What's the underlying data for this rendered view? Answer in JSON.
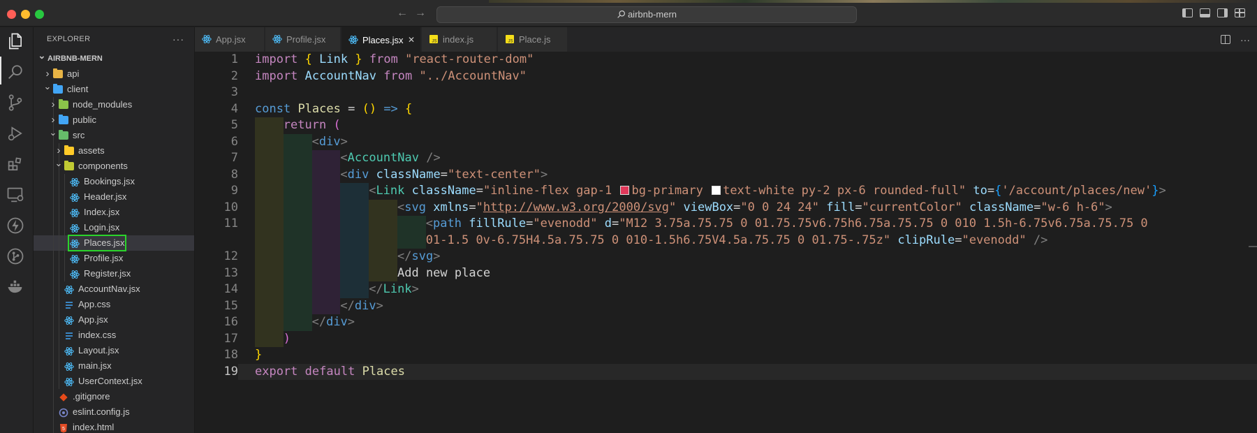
{
  "titlebar": {
    "search_text": "airbnb-mern"
  },
  "explorer": {
    "header": "EXPLORER",
    "more": "···",
    "tree": [
      {
        "label": "AIRBNB-MERN",
        "depth": 0,
        "type": "root",
        "expanded": true
      },
      {
        "label": "api",
        "depth": 1,
        "type": "folder",
        "expanded": false,
        "color": "#e8b445"
      },
      {
        "label": "client",
        "depth": 1,
        "type": "folder",
        "expanded": true,
        "color": "#42a5f5"
      },
      {
        "label": "node_modules",
        "depth": 2,
        "type": "folder",
        "expanded": false,
        "color": "#8bc34a"
      },
      {
        "label": "public",
        "depth": 2,
        "type": "folder",
        "expanded": false,
        "color": "#42a5f5"
      },
      {
        "label": "src",
        "depth": 2,
        "type": "folder",
        "expanded": true,
        "color": "#66bb6a"
      },
      {
        "label": "assets",
        "depth": 3,
        "type": "folder",
        "expanded": false,
        "color": "#ffca28"
      },
      {
        "label": "components",
        "depth": 3,
        "type": "folder",
        "expanded": true,
        "color": "#c0ca33"
      },
      {
        "label": "Bookings.jsx",
        "depth": 4,
        "type": "react"
      },
      {
        "label": "Header.jsx",
        "depth": 4,
        "type": "react"
      },
      {
        "label": "Index.jsx",
        "depth": 4,
        "type": "react"
      },
      {
        "label": "Login.jsx",
        "depth": 4,
        "type": "react"
      },
      {
        "label": "Places.jsx",
        "depth": 4,
        "type": "react",
        "selected": true,
        "highlighted": true
      },
      {
        "label": "Profile.jsx",
        "depth": 4,
        "type": "react"
      },
      {
        "label": "Register.jsx",
        "depth": 4,
        "type": "react"
      },
      {
        "label": "AccountNav.jsx",
        "depth": 3,
        "type": "react"
      },
      {
        "label": "App.css",
        "depth": 3,
        "type": "css"
      },
      {
        "label": "App.jsx",
        "depth": 3,
        "type": "react"
      },
      {
        "label": "index.css",
        "depth": 3,
        "type": "css"
      },
      {
        "label": "Layout.jsx",
        "depth": 3,
        "type": "react"
      },
      {
        "label": "main.jsx",
        "depth": 3,
        "type": "react"
      },
      {
        "label": "UserContext.jsx",
        "depth": 3,
        "type": "react"
      },
      {
        "label": ".gitignore",
        "depth": 2,
        "type": "git"
      },
      {
        "label": "eslint.config.js",
        "depth": 2,
        "type": "eslint"
      },
      {
        "label": "index.html",
        "depth": 2,
        "type": "html"
      }
    ]
  },
  "tabs": [
    {
      "label": "App.jsx",
      "type": "react",
      "active": false
    },
    {
      "label": "Profile.jsx",
      "type": "react",
      "active": false
    },
    {
      "label": "Places.jsx",
      "type": "react",
      "active": true
    },
    {
      "label": "index.js",
      "type": "js",
      "active": false
    },
    {
      "label": "Place.js",
      "type": "js",
      "active": false
    }
  ],
  "editor": {
    "current_line": 19,
    "lines": [
      {
        "n": "1",
        "depth": 0,
        "tokens": [
          [
            "kw",
            "import"
          ],
          [
            "txt",
            " "
          ],
          [
            "br1",
            "{"
          ],
          [
            "txt",
            " "
          ],
          [
            "var",
            "Link"
          ],
          [
            "txt",
            " "
          ],
          [
            "br1",
            "}"
          ],
          [
            "txt",
            " "
          ],
          [
            "kw",
            "from"
          ],
          [
            "txt",
            " "
          ],
          [
            "str",
            "\"react-router-dom\""
          ]
        ]
      },
      {
        "n": "2",
        "depth": 0,
        "tokens": [
          [
            "kw",
            "import"
          ],
          [
            "txt",
            " "
          ],
          [
            "var",
            "AccountNav"
          ],
          [
            "txt",
            " "
          ],
          [
            "kw",
            "from"
          ],
          [
            "txt",
            " "
          ],
          [
            "str",
            "\"../AccountNav\""
          ]
        ]
      },
      {
        "n": "3",
        "depth": 0,
        "tokens": []
      },
      {
        "n": "4",
        "depth": 0,
        "tokens": [
          [
            "kw2",
            "const"
          ],
          [
            "txt",
            " "
          ],
          [
            "ident",
            "Places"
          ],
          [
            "txt",
            " = "
          ],
          [
            "br1",
            "()"
          ],
          [
            "txt",
            " "
          ],
          [
            "kw2",
            "=>"
          ],
          [
            "txt",
            " "
          ],
          [
            "br1",
            "{"
          ]
        ]
      },
      {
        "n": "5",
        "depth": 1,
        "tokens": [
          [
            "kw",
            "return"
          ],
          [
            "txt",
            " "
          ],
          [
            "br2",
            "("
          ]
        ]
      },
      {
        "n": "6",
        "depth": 2,
        "tokens": [
          [
            "punct",
            "<"
          ],
          [
            "tag",
            "div"
          ],
          [
            "punct",
            ">"
          ]
        ]
      },
      {
        "n": "7",
        "depth": 3,
        "tokens": [
          [
            "punct",
            "<"
          ],
          [
            "comp",
            "AccountNav"
          ],
          [
            "txt",
            " "
          ],
          [
            "punct",
            "/>"
          ]
        ]
      },
      {
        "n": "8",
        "depth": 3,
        "tokens": [
          [
            "punct",
            "<"
          ],
          [
            "tag",
            "div"
          ],
          [
            "txt",
            " "
          ],
          [
            "attr",
            "className"
          ],
          [
            "txt",
            "="
          ],
          [
            "str",
            "\"text-center\""
          ],
          [
            "punct",
            ">"
          ]
        ]
      },
      {
        "n": "9",
        "depth": 4,
        "tokens": [
          [
            "punct",
            "<"
          ],
          [
            "comp",
            "Link"
          ],
          [
            "txt",
            " "
          ],
          [
            "attr",
            "className"
          ],
          [
            "txt",
            "="
          ],
          [
            "str",
            "\"inline-flex gap-1 "
          ],
          [
            "swatch",
            "#e0385a"
          ],
          [
            "str",
            "bg-primary "
          ],
          [
            "swatch",
            "#ffffff"
          ],
          [
            "str",
            "text-white py-2 px-6 rounded-full\""
          ],
          [
            "txt",
            " "
          ],
          [
            "attr",
            "to"
          ],
          [
            "txt",
            "="
          ],
          [
            "br3",
            "{"
          ],
          [
            "str",
            "'/account/places/new'"
          ],
          [
            "br3",
            "}"
          ],
          [
            "punct",
            ">"
          ]
        ]
      },
      {
        "n": "10",
        "depth": 5,
        "tokens": [
          [
            "punct",
            "<"
          ],
          [
            "tag",
            "svg"
          ],
          [
            "txt",
            " "
          ],
          [
            "attr",
            "xmlns"
          ],
          [
            "txt",
            "="
          ],
          [
            "str",
            "\""
          ],
          [
            "link",
            "http://www.w3.org/2000/svg"
          ],
          [
            "str",
            "\""
          ],
          [
            "txt",
            " "
          ],
          [
            "attr",
            "viewBox"
          ],
          [
            "txt",
            "="
          ],
          [
            "str",
            "\"0 0 24 24\""
          ],
          [
            "txt",
            " "
          ],
          [
            "attr",
            "fill"
          ],
          [
            "txt",
            "="
          ],
          [
            "str",
            "\"currentColor\""
          ],
          [
            "txt",
            " "
          ],
          [
            "attr",
            "className"
          ],
          [
            "txt",
            "="
          ],
          [
            "str",
            "\"w-6 h-6\""
          ],
          [
            "punct",
            ">"
          ]
        ]
      },
      {
        "n": "11",
        "depth": 6,
        "tokens": [
          [
            "punct",
            "<"
          ],
          [
            "tag",
            "path"
          ],
          [
            "txt",
            " "
          ],
          [
            "attr",
            "fillRule"
          ],
          [
            "txt",
            "="
          ],
          [
            "str",
            "\"evenodd\""
          ],
          [
            "txt",
            " "
          ],
          [
            "attr",
            "d"
          ],
          [
            "txt",
            "="
          ],
          [
            "str",
            "\"M12 3.75a.75.75 0 01.75.75v6.75h6.75a.75.75 0 010 1.5h-6.75v6.75a.75.75 0"
          ]
        ]
      },
      {
        "n": "",
        "depth": 6,
        "tokens": [
          [
            "str",
            "01-1.5 0v-6.75H4.5a.75.75 0 010-1.5h6.75V4.5a.75.75 0 01.75-.75z\""
          ],
          [
            "txt",
            " "
          ],
          [
            "attr",
            "clipRule"
          ],
          [
            "txt",
            "="
          ],
          [
            "str",
            "\"evenodd\""
          ],
          [
            "txt",
            " "
          ],
          [
            "punct",
            "/>"
          ]
        ]
      },
      {
        "n": "12",
        "depth": 5,
        "tokens": [
          [
            "punct",
            "</"
          ],
          [
            "tag",
            "svg"
          ],
          [
            "punct",
            ">"
          ]
        ]
      },
      {
        "n": "13",
        "depth": 5,
        "tokens": [
          [
            "txt",
            "Add new place"
          ]
        ]
      },
      {
        "n": "14",
        "depth": 4,
        "tokens": [
          [
            "punct",
            "</"
          ],
          [
            "comp",
            "Link"
          ],
          [
            "punct",
            ">"
          ]
        ]
      },
      {
        "n": "15",
        "depth": 3,
        "tokens": [
          [
            "punct",
            "</"
          ],
          [
            "tag",
            "div"
          ],
          [
            "punct",
            ">"
          ]
        ]
      },
      {
        "n": "16",
        "depth": 2,
        "tokens": [
          [
            "punct",
            "</"
          ],
          [
            "tag",
            "div"
          ],
          [
            "punct",
            ">"
          ]
        ]
      },
      {
        "n": "17",
        "depth": 1,
        "tokens": [
          [
            "br2",
            ")"
          ]
        ]
      },
      {
        "n": "18",
        "depth": 0,
        "tokens": [
          [
            "br1",
            "}"
          ]
        ]
      },
      {
        "n": "19",
        "depth": 0,
        "tokens": [
          [
            "kw",
            "export"
          ],
          [
            "txt",
            " "
          ],
          [
            "kw",
            "default"
          ],
          [
            "txt",
            " "
          ],
          [
            "ident",
            "Places"
          ]
        ]
      }
    ]
  }
}
